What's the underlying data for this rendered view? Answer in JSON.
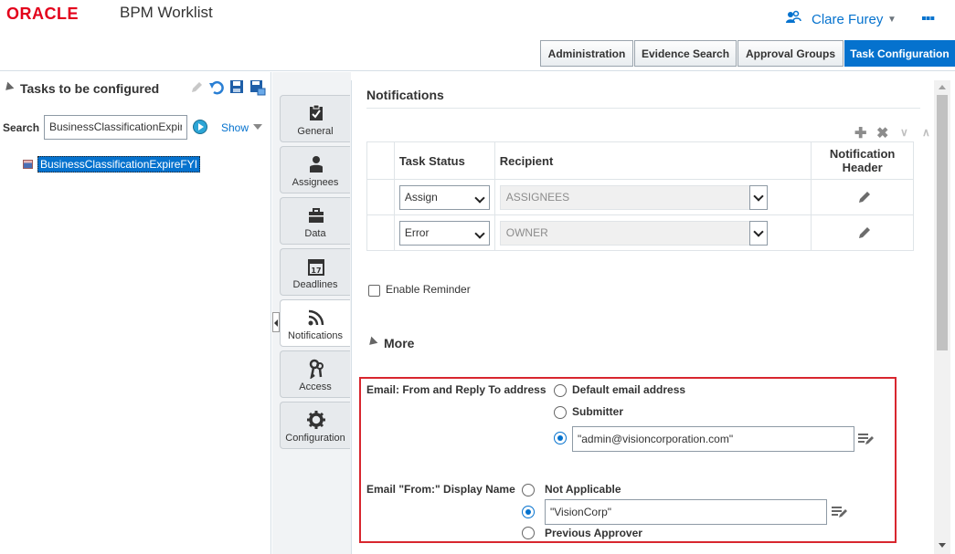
{
  "header": {
    "logo": "ORACLE",
    "app_title": "BPM Worklist",
    "user_name": "Clare Furey",
    "more": "▪▪▪"
  },
  "top_tabs": [
    {
      "label": "Administration"
    },
    {
      "label": "Evidence Search"
    },
    {
      "label": "Approval Groups"
    },
    {
      "label": "Task Configuration"
    }
  ],
  "left": {
    "title": "Tasks to be configured",
    "search_label": "Search",
    "search_value": "BusinessClassificationExpir",
    "show_label": "Show",
    "tree_node": "BusinessClassificationExpireFYI"
  },
  "vtabs": [
    {
      "label": "General"
    },
    {
      "label": "Assignees"
    },
    {
      "label": "Data"
    },
    {
      "label": "Deadlines"
    },
    {
      "label": "Notifications"
    },
    {
      "label": "Access"
    },
    {
      "label": "Configuration"
    }
  ],
  "notifications": {
    "title": "Notifications",
    "columns": {
      "task_status": "Task Status",
      "recipient": "Recipient",
      "header_line1": "Notification",
      "header_line2": "Header"
    },
    "rows": [
      {
        "status": "Assign",
        "recipient": "ASSIGNEES"
      },
      {
        "status": "Error",
        "recipient": "OWNER"
      }
    ],
    "enable_reminder": "Enable Reminder",
    "more": "More"
  },
  "email": {
    "from_reply_label": "Email: From and Reply To address",
    "opt_default": "Default email address",
    "opt_submitter": "Submitter",
    "custom_value": "\"admin@visioncorporation.com\"",
    "display_name_label": "Email \"From:\" Display Name",
    "opt_not_applicable": "Not Applicable",
    "display_value": "\"VisionCorp\"",
    "opt_previous_approver": "Previous Approver"
  },
  "colors": {
    "accent": "#0572ce",
    "brand": "#e3001b",
    "highlight": "#d8262e"
  }
}
